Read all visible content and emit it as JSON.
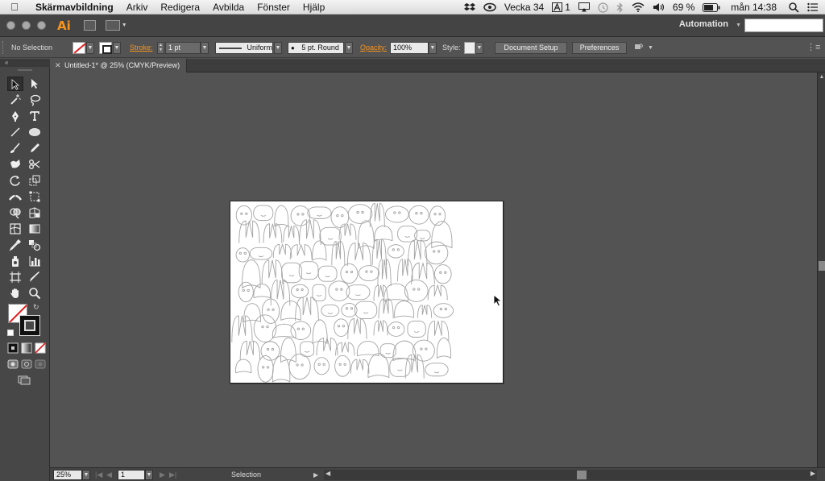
{
  "menubar": {
    "app_name": "Skärmavbildning",
    "items": [
      "Arkiv",
      "Redigera",
      "Avbilda",
      "Fönster",
      "Hjälp"
    ],
    "week": "Vecka 34",
    "adobe_badge": "1",
    "battery": "69 %",
    "clock": "mån 14:38"
  },
  "appbar": {
    "logo": "Ai",
    "workspace": "Automation"
  },
  "control": {
    "selection": "No Selection",
    "stroke_label": "Stroke:",
    "stroke_weight": "1 pt",
    "profile": "Uniform",
    "brush": "5 pt. Round",
    "opacity_label": "Opacity:",
    "opacity": "100%",
    "style_label": "Style:",
    "document_setup": "Document Setup",
    "preferences": "Preferences"
  },
  "tab": {
    "title": "Untitled-1* @ 25% (CMYK/Preview)"
  },
  "status": {
    "zoom": "25%",
    "artboard": "1",
    "tool": "Selection"
  },
  "colors": {
    "accent_orange": "#f7941e",
    "canvas_bg": "#535353",
    "panel_bg": "#474747"
  }
}
